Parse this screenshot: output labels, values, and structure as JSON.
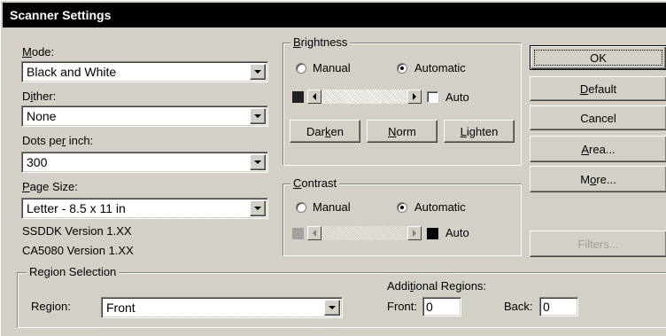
{
  "window": {
    "title": "Scanner Settings"
  },
  "left": {
    "mode": {
      "label": "Mode:",
      "value": "Black and White"
    },
    "dither": {
      "label": "Dither:",
      "value": "None"
    },
    "dpi": {
      "label": "Dots per inch:",
      "value": "300"
    },
    "page_size": {
      "label": "Page Size:",
      "value": "Letter - 8.5 x 11 in"
    },
    "version_ssddk": "SSDDK Version 1.XX",
    "version_ca5080": "CA5080 Version 1.XX"
  },
  "brightness": {
    "title": "Brightness",
    "manual_label": "Manual",
    "automatic_label": "Automatic",
    "selected": "Automatic",
    "auto_label": "Auto",
    "auto_checked": false,
    "darken_label": "Darken",
    "norm_label": "Norm",
    "lighten_label": "Lighten",
    "swatch_color": "#202020"
  },
  "contrast": {
    "title": "Contrast",
    "manual_label": "Manual",
    "automatic_label": "Automatic",
    "selected": "Automatic",
    "auto_label": "Auto",
    "swatch_color": "#a0a0a0"
  },
  "buttons": {
    "ok": "OK",
    "default": "Default",
    "cancel": "Cancel",
    "area": "Area...",
    "more": "More...",
    "filters": "Filters..."
  },
  "region_selection": {
    "title": "Region Selection",
    "region_label": "Region:",
    "region_value": "Front",
    "additional_label": "Additional Regions:",
    "front_label": "Front:",
    "front_value": "0",
    "back_label": "Back:",
    "back_value": "0"
  },
  "colors": {
    "face": "#d4d0c8",
    "titlebar": "#000000",
    "disabled_text": "#a0a0a0"
  }
}
